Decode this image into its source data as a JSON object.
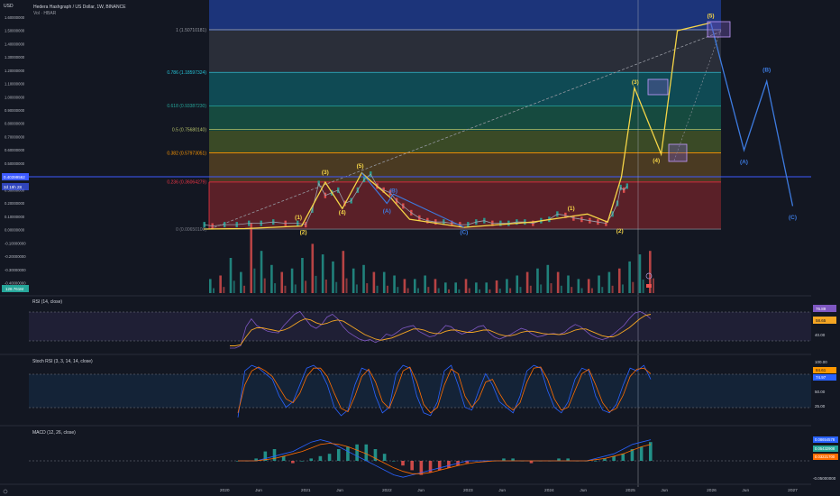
{
  "header": {
    "currency": "USD",
    "title": "Hedera Hashgraph / US Dollar, 1W, BINANCE",
    "volume_label": "Vol · HBAR"
  },
  "price_axis": {
    "ticks": [
      "1.60000000",
      "1.50000000",
      "1.40000000",
      "1.30000000",
      "1.20000000",
      "1.10000000",
      "1.00000000",
      "0.90000000",
      "0.80000000",
      "0.70000000",
      "0.60000000",
      "0.50000000",
      "0.40000000",
      "0.30000000",
      "0.20000000",
      "0.10000000",
      "0.00000000",
      "-0.10000000",
      "-0.20000000",
      "-0.30000000",
      "-0.40000000"
    ],
    "current_price": "0.40399562",
    "countdown": "2d 19h 28",
    "volume_badge": "128.761M"
  },
  "fib_levels": [
    {
      "label": "1 (1.50710181)",
      "value": 1.50710181,
      "color": "#9598a1"
    },
    {
      "label": "0.786 (1.18597324)",
      "value": 1.18597324,
      "color": "#26c6da"
    },
    {
      "label": "0.618 (0.93387230)",
      "value": 0.9338723,
      "color": "#26a69a"
    },
    {
      "label": "0.5 (0.75680140)",
      "value": 0.7568014,
      "color": "#b6c26a"
    },
    {
      "label": "0.382 (0.57973051)",
      "value": 0.57973051,
      "color": "#ff9800"
    },
    {
      "label": "0.236 (0.36064279)",
      "value": 0.36064279,
      "color": "#f23645"
    },
    {
      "label": "0 (0.00650100)",
      "value": 0.006501,
      "color": "#787b86"
    }
  ],
  "wave_labels": {
    "w1": "(1)",
    "w2": "(2)",
    "w3": "(3)",
    "w4": "(4)",
    "w5": "(5)",
    "wa": "(A)",
    "wb": "(B)",
    "wc": "(C)"
  },
  "rsi": {
    "label": "RSI (14, close)",
    "ticks": [
      "70.00",
      "40.00"
    ],
    "value1": "76.89",
    "value2": "58.65"
  },
  "stoch": {
    "label": "Stoch RSI (3, 3, 14, 14, close)",
    "ticks": [
      "100.00",
      "75.00",
      "50.00",
      "25.00"
    ],
    "value1": "84.61",
    "value2": "74.97"
  },
  "macd": {
    "label": "MACD (12, 26, close)",
    "ticks": [
      "-0.05000000"
    ],
    "value1": "0.08654578",
    "value2": "0.03221700",
    "value3": "0.05432908"
  },
  "time_axis": {
    "labels": [
      "2020",
      "Jun",
      "2021",
      "Jun",
      "2022",
      "Jun",
      "2023",
      "Jun",
      "2024",
      "Jun",
      "2025",
      "Jun",
      "2026",
      "Jun",
      "2027"
    ]
  },
  "chart_data": {
    "type": "line",
    "title": "Hedera Hashgraph / US Dollar, 1W, BINANCE",
    "xlabel": "",
    "ylabel": "",
    "ylim": [
      -0.45,
      1.62
    ],
    "x_range": [
      2019.72,
      2027.15
    ],
    "grid": false,
    "series": [
      {
        "name": "HBAR close",
        "x": [
          2019.75,
          2019.85,
          2020.0,
          2020.15,
          2020.3,
          2020.45,
          2020.6,
          2020.75,
          2020.9,
          2021.0,
          2021.08,
          2021.16,
          2021.24,
          2021.32,
          2021.4,
          2021.48,
          2021.56,
          2021.64,
          2021.72,
          2021.8,
          2021.88,
          2021.96,
          2022.04,
          2022.12,
          2022.2,
          2022.3,
          2022.4,
          2022.5,
          2022.6,
          2022.7,
          2022.8,
          2022.9,
          2023.0,
          2023.1,
          2023.2,
          2023.3,
          2023.4,
          2023.5,
          2023.6,
          2023.7,
          2023.8,
          2023.9,
          2024.0,
          2024.1,
          2024.2,
          2024.3,
          2024.4,
          2024.5,
          2024.6,
          2024.7,
          2024.78,
          2024.84,
          2024.88,
          2024.92,
          2024.96
        ],
        "y": [
          0.04,
          0.03,
          0.04,
          0.04,
          0.05,
          0.05,
          0.06,
          0.05,
          0.05,
          0.04,
          0.15,
          0.35,
          0.26,
          0.28,
          0.3,
          0.2,
          0.22,
          0.3,
          0.38,
          0.42,
          0.33,
          0.3,
          0.28,
          0.22,
          0.18,
          0.13,
          0.09,
          0.07,
          0.06,
          0.06,
          0.05,
          0.04,
          0.04,
          0.06,
          0.07,
          0.05,
          0.05,
          0.05,
          0.06,
          0.06,
          0.05,
          0.07,
          0.08,
          0.12,
          0.11,
          0.09,
          0.08,
          0.07,
          0.06,
          0.05,
          0.12,
          0.2,
          0.32,
          0.3,
          0.33
        ]
      },
      {
        "name": "Elliott wave count",
        "x": [
          2019.74,
          2020.25,
          2020.95,
          2021.24,
          2021.45,
          2021.69,
          2021.8,
          2022.05,
          2022.28,
          2022.95,
          2023.8,
          2024.47,
          2024.72,
          2024.89,
          2025.05,
          2025.38,
          2025.58,
          2025.99
        ],
        "y": [
          0.007,
          0.01,
          0.03,
          0.36,
          0.16,
          0.43,
          0.37,
          0.24,
          0.08,
          0.02,
          0.06,
          0.12,
          0.06,
          0.4,
          1.07,
          0.57,
          1.5,
          1.56
        ]
      },
      {
        "name": "Projected ABC",
        "x": [
          2025.99,
          2026.4,
          2026.68,
          2027.0
        ],
        "y": [
          1.56,
          0.6,
          1.12,
          0.18
        ]
      }
    ],
    "annotations": [
      {
        "text": "(1)",
        "x": 2020.91,
        "y": 0.08,
        "series": "impulse"
      },
      {
        "text": "(2)",
        "x": 2020.97,
        "y": -0.03,
        "series": "impulse"
      },
      {
        "text": "(3)",
        "x": 2021.24,
        "y": 0.42,
        "series": "impulse"
      },
      {
        "text": "(4)",
        "x": 2021.45,
        "y": 0.12,
        "series": "impulse"
      },
      {
        "text": "(5)",
        "x": 2021.67,
        "y": 0.47,
        "series": "impulse"
      },
      {
        "text": "(A)",
        "x": 2022.0,
        "y": 0.13,
        "series": "correction"
      },
      {
        "text": "(B)",
        "x": 2022.08,
        "y": 0.28,
        "series": "correction"
      },
      {
        "text": "(C)",
        "x": 2022.95,
        "y": -0.03,
        "series": "correction"
      },
      {
        "text": "(1)",
        "x": 2024.27,
        "y": 0.15,
        "series": "impulse"
      },
      {
        "text": "(2)",
        "x": 2024.87,
        "y": -0.02,
        "series": "impulse"
      },
      {
        "text": "(3)",
        "x": 2025.06,
        "y": 1.1,
        "series": "impulse"
      },
      {
        "text": "(4)",
        "x": 2025.32,
        "y": 0.51,
        "series": "impulse"
      },
      {
        "text": "(5)",
        "x": 2025.99,
        "y": 1.6,
        "series": "impulse"
      },
      {
        "text": "(A)",
        "x": 2026.4,
        "y": 0.5,
        "series": "correction"
      },
      {
        "text": "(B)",
        "x": 2026.68,
        "y": 1.19,
        "series": "correction"
      },
      {
        "text": "(C)",
        "x": 2027.0,
        "y": 0.08,
        "series": "correction"
      }
    ],
    "volume": [
      0.2,
      0.25,
      0.5,
      0.3,
      1.0,
      0.6,
      0.4,
      0.3,
      0.35,
      0.5,
      0.7,
      0.55,
      0.45,
      0.6,
      0.35,
      0.4,
      0.3,
      0.3,
      0.25,
      0.2,
      0.2,
      0.25,
      0.2,
      0.15,
      0.15,
      0.2,
      0.15,
      0.15,
      0.18,
      0.2,
      0.25,
      0.3,
      0.35,
      0.4,
      0.3,
      0.25,
      0.2,
      0.2,
      0.25,
      0.3,
      0.35,
      0.45,
      0.55,
      0.6
    ],
    "rsi_values": [
      20,
      20,
      24,
      58,
      72,
      60,
      55,
      50,
      48,
      47,
      60,
      70,
      80,
      85,
      72,
      60,
      55,
      62,
      75,
      80,
      72,
      58,
      48,
      42,
      36,
      33,
      35,
      30,
      35,
      45,
      42,
      48,
      55,
      58,
      60,
      50,
      45,
      40,
      42,
      50,
      60,
      58,
      50,
      45,
      48,
      52,
      58,
      60,
      48,
      40,
      36,
      40,
      44,
      50,
      55,
      52,
      45,
      40,
      42,
      45,
      46,
      44,
      48,
      56,
      62,
      58,
      50,
      42,
      38,
      35,
      38,
      44,
      52,
      60,
      72,
      82,
      85,
      80,
      72
    ],
    "rsi_ma_values": [
      24,
      24,
      26,
      40,
      52,
      56,
      56,
      54,
      52,
      50,
      52,
      56,
      62,
      68,
      72,
      70,
      65,
      62,
      64,
      68,
      70,
      68,
      62,
      56,
      50,
      44,
      40,
      36,
      34,
      36,
      38,
      42,
      46,
      50,
      54,
      54,
      52,
      48,
      46,
      46,
      50,
      52,
      52,
      50,
      48,
      48,
      50,
      52,
      52,
      48,
      44,
      42,
      42,
      44,
      48,
      50,
      50,
      48,
      46,
      45,
      45,
      44,
      45,
      48,
      52,
      54,
      54,
      50,
      46,
      42,
      40,
      40,
      44,
      50,
      56,
      64,
      72,
      78,
      80
    ],
    "stoch_k": [
      2,
      85,
      95,
      90,
      80,
      70,
      40,
      20,
      30,
      60,
      90,
      95,
      85,
      60,
      20,
      5,
      15,
      60,
      90,
      85,
      40,
      10,
      20,
      80,
      95,
      90,
      40,
      10,
      5,
      30,
      85,
      95,
      60,
      20,
      15,
      50,
      80,
      60,
      30,
      20,
      10,
      40,
      85,
      95,
      90,
      50,
      20,
      10,
      30,
      70,
      90,
      85,
      40,
      15,
      10,
      25,
      60,
      90,
      85,
      95,
      70
    ],
    "stoch_d": [
      10,
      60,
      85,
      92,
      85,
      75,
      55,
      35,
      28,
      45,
      75,
      90,
      90,
      75,
      45,
      18,
      12,
      40,
      75,
      88,
      65,
      30,
      18,
      50,
      85,
      92,
      65,
      25,
      10,
      20,
      60,
      88,
      80,
      40,
      20,
      35,
      65,
      70,
      45,
      25,
      15,
      28,
      65,
      90,
      92,
      70,
      35,
      15,
      20,
      50,
      80,
      88,
      60,
      28,
      12,
      18,
      42,
      75,
      88,
      90,
      80
    ],
    "macd_hist": [
      0.0,
      0.0,
      0.01,
      0.04,
      0.05,
      0.02,
      -0.01,
      0.0,
      0.01,
      0.02,
      0.03,
      0.05,
      0.06,
      0.07,
      0.07,
      0.05,
      0.03,
      0.0,
      -0.02,
      -0.04,
      -0.06,
      -0.05,
      -0.04,
      -0.03,
      -0.02,
      -0.01,
      0.0,
      0.0,
      0.0,
      0.01,
      0.01,
      0.0,
      -0.01,
      0.0,
      0.0,
      0.01,
      0.01,
      0.0,
      0.0,
      0.0,
      0.01,
      0.02,
      0.03,
      0.05,
      0.06,
      0.08
    ],
    "macd_line": [
      0.0,
      0.0,
      0.0,
      0.01,
      0.02,
      0.03,
      0.04,
      0.06,
      0.08,
      0.09,
      0.08,
      0.06,
      0.04,
      0.02,
      0.0,
      -0.02,
      -0.04,
      -0.06,
      -0.07,
      -0.06,
      -0.05,
      -0.04,
      -0.03,
      -0.02,
      -0.01,
      0.0,
      0.0,
      0.0,
      0.0,
      0.0,
      0.0,
      0.0,
      0.0,
      0.0,
      0.0,
      0.0,
      0.0,
      0.0,
      0.0,
      0.01,
      0.02,
      0.03,
      0.05,
      0.07,
      0.08,
      0.09
    ],
    "macd_signal": [
      0.0,
      0.0,
      0.0,
      0.005,
      0.01,
      0.02,
      0.03,
      0.04,
      0.055,
      0.07,
      0.075,
      0.07,
      0.06,
      0.045,
      0.03,
      0.01,
      -0.01,
      -0.03,
      -0.045,
      -0.055,
      -0.055,
      -0.05,
      -0.04,
      -0.03,
      -0.02,
      -0.012,
      -0.006,
      -0.003,
      0.0,
      0.0,
      0.0,
      0.0,
      0.0,
      0.0,
      0.0,
      0.0,
      0.0,
      0.0,
      0.0,
      0.005,
      0.01,
      0.02,
      0.03,
      0.045,
      0.06,
      0.07
    ]
  },
  "colors": {
    "background": "#131722",
    "impulse": "#f5d547",
    "correction": "#3d7be0",
    "up": "#26a69a",
    "down": "#ef5350",
    "rsi_line": "#7e57c2",
    "rsi_ma": "#f5a623",
    "macd_line": "#2962ff",
    "macd_signal": "#ff6d00",
    "price_line": "#3d5afe"
  }
}
